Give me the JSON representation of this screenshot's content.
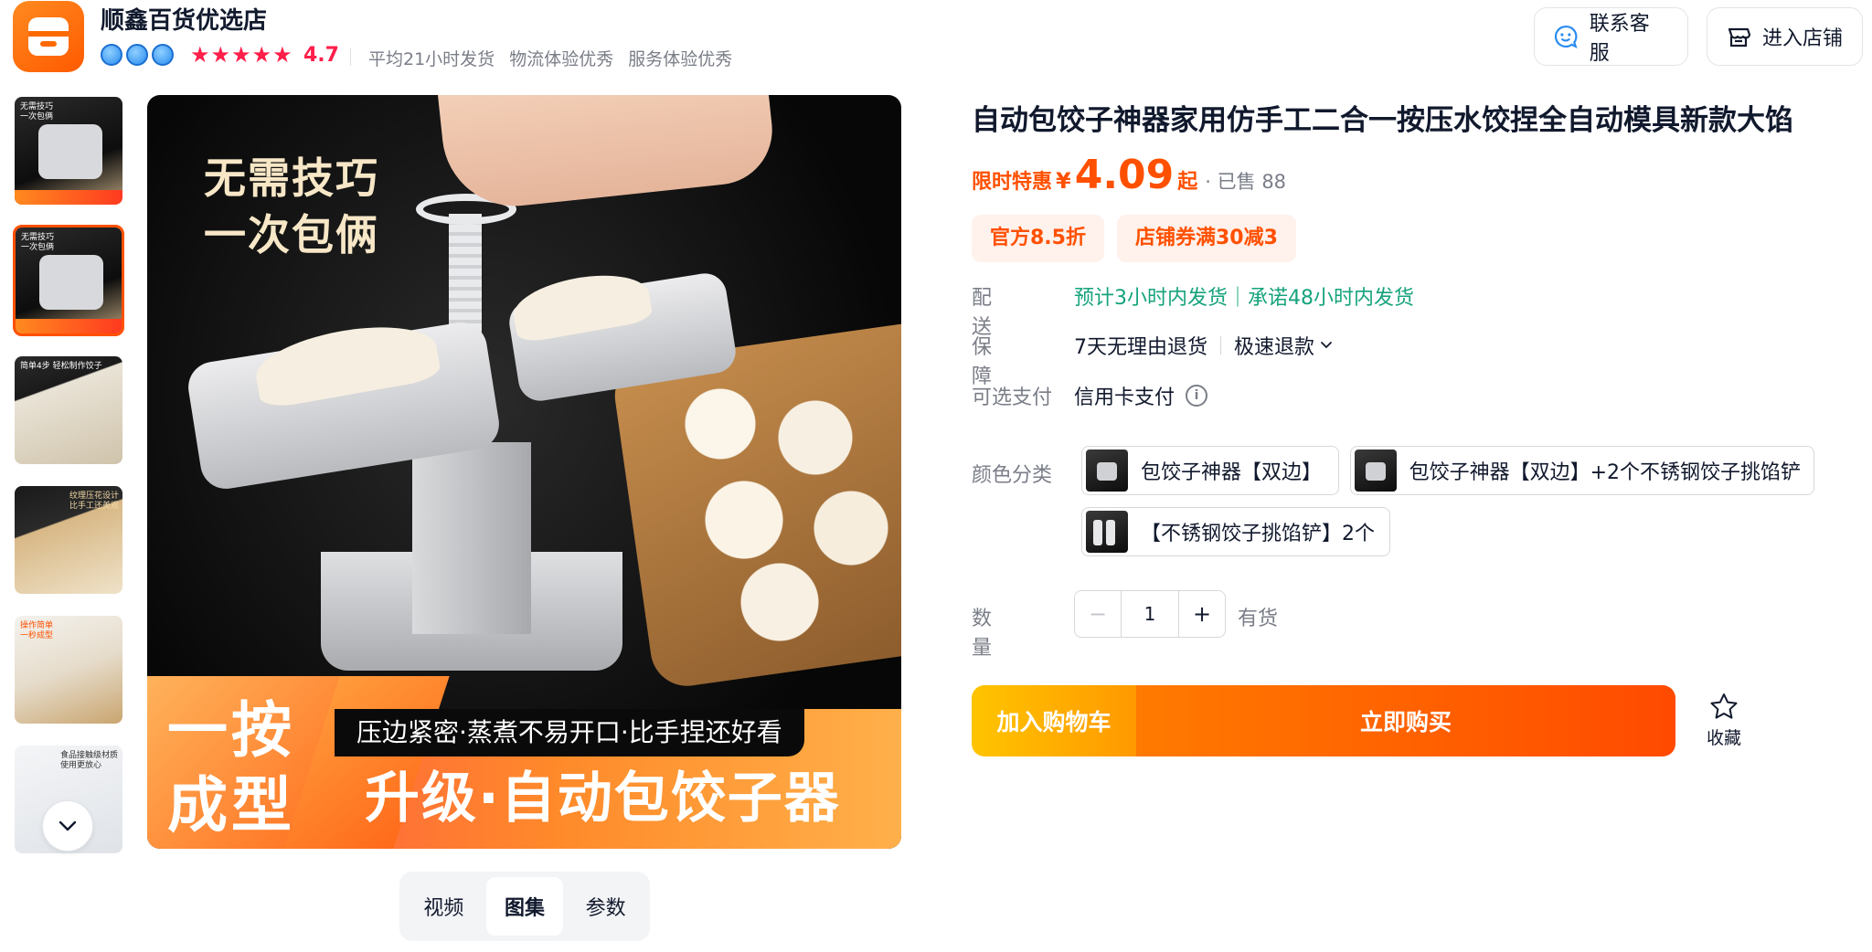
{
  "shop": {
    "name": "顺鑫百货优选店",
    "rating": "4.7",
    "stats": [
      "平均21小时发货",
      "物流体验优秀",
      "服务体验优秀"
    ],
    "service_button": "联系客服",
    "store_button": "进入店铺"
  },
  "gallery": {
    "thumbs": [
      {
        "caption": "无需技巧\n一次包俩",
        "style": "dark"
      },
      {
        "caption": "无需技巧\n一次包俩",
        "style": "dark"
      },
      {
        "caption": "简单4步 轻松制作饺子",
        "style": "white"
      },
      {
        "caption": "纹理压花设计\n比手工还美观",
        "style": "light"
      },
      {
        "caption": "操作简单\n一秒成型",
        "style": "light"
      },
      {
        "caption": "食品接触级材质\n使用更放心",
        "style": "white"
      }
    ],
    "main_image": {
      "tagline": [
        "无需技巧",
        "一次包俩"
      ],
      "slogan_big": [
        "一按",
        "成型"
      ],
      "slogan_sub": "压边紧密·蒸煮不易开口·比手捏还好看",
      "slogan_upgrade": "升级·自动包饺子器"
    },
    "tabs": [
      "视频",
      "图集",
      "参数"
    ],
    "active_tab": "图集"
  },
  "product": {
    "title": "自动包饺子神器家用仿手工二合一按压水饺捏全自动模具新款大馅",
    "promo_label": "限时特惠",
    "currency": "¥",
    "price": "4.09",
    "price_suffix": "起",
    "sold": "· 已售 88",
    "coupons": [
      "官方8.5折",
      "店铺券满30减3"
    ],
    "shipping_label": "配送",
    "shipping_text": "预计3小时内发货｜承诺48小时内发货",
    "guarantee_label": "保障",
    "guarantee_items": [
      "7天无理由退货",
      "极速退款"
    ],
    "payment_label": "可选支付",
    "payment_text": "信用卡支付",
    "sku_label": "颜色分类",
    "skus": [
      "包饺子神器【双边】",
      "包饺子神器【双边】+2个不锈钢饺子挑馅铲",
      "【不锈钢饺子挑馅铲】2个"
    ],
    "quantity_label": "数量",
    "quantity": "1",
    "stock": "有货",
    "add_cart": "加入购物车",
    "buy_now": "立即购买",
    "favorite": "收藏"
  },
  "colors": {
    "accent": "#ff5000",
    "star": "#ff1f4b",
    "shipping": "#16a37d",
    "cart_gradient": [
      "#ffc400",
      "#ff9900"
    ],
    "buy_gradient": [
      "#ff7a00",
      "#ff4a00"
    ]
  },
  "icons": {
    "service": "smiley-bubble-icon",
    "store": "storefront-icon",
    "favorite": "star-outline-icon",
    "thumbs_down": "chevron-down-icon",
    "payment_info": "info-circle-icon",
    "guarantee_more": "chevron-down-icon"
  }
}
